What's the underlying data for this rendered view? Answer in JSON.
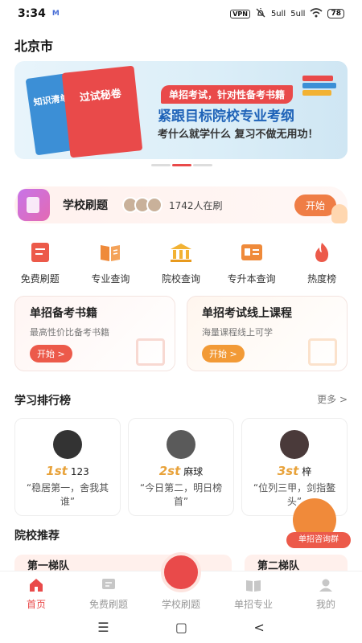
{
  "status_bar": {
    "time": "3:34",
    "badge": "M",
    "vpn": "VPN",
    "signal1": "5ull",
    "signal2": "5ull",
    "battery": "78"
  },
  "location": {
    "city": "北京市"
  },
  "banner": {
    "book1_text": "知识清单",
    "book2_text": "过试秘卷",
    "tag": "单招考试，针对性备考书籍",
    "title": "紧跟目标院校专业考纲",
    "subtitle": "考什么就学什么 复习不做无用功！"
  },
  "school_practice": {
    "title": "学校刷题",
    "online_count": "1742人在刷",
    "start_label": "开始"
  },
  "quick_actions": [
    {
      "label": "免费刷题",
      "icon": "notebook-icon",
      "color": "#ec5a4a"
    },
    {
      "label": "专业查询",
      "icon": "book-icon",
      "color": "#ef8a3a"
    },
    {
      "label": "院校查询",
      "icon": "school-icon",
      "color": "#f2b233"
    },
    {
      "label": "专升本查询",
      "icon": "card-icon",
      "color": "#ef8a3a"
    },
    {
      "label": "热度榜",
      "icon": "flame-icon",
      "color": "#ec5a4a"
    }
  ],
  "promos": [
    {
      "title": "单招备考书籍",
      "subtitle": "最高性价比备考书籍",
      "button": "开始 >"
    },
    {
      "title": "单招考试线上课程",
      "subtitle": "海量课程线上可学",
      "button": "开始 >"
    }
  ],
  "ranking": {
    "title": "学习排行榜",
    "more": "更多 >",
    "items": [
      {
        "pos": "1st",
        "name": "123",
        "quote": "“稳居第一，舍我其谁”"
      },
      {
        "pos": "2st",
        "name": "麻球",
        "quote": "“今日第二，明日榜首”"
      },
      {
        "pos": "3st",
        "name": "梓",
        "quote": "“位列三甲，剑指鳌头”"
      }
    ]
  },
  "consult": {
    "label": "单招咨询群"
  },
  "recommend": {
    "title": "院校推荐",
    "peek_left": "第一梯队",
    "peek_right": "第二梯队"
  },
  "tabbar": [
    {
      "label": "首页",
      "icon": "home-icon",
      "active": true
    },
    {
      "label": "免费刷题",
      "icon": "chat-icon",
      "active": false
    },
    {
      "label": "学校刷题",
      "icon": "pen-icon",
      "active": false
    },
    {
      "label": "单招专业",
      "icon": "book-icon",
      "active": false
    },
    {
      "label": "我的",
      "icon": "user-icon",
      "active": false
    }
  ],
  "navbar": {
    "menu": "☰",
    "home": "▢",
    "back": "<"
  }
}
